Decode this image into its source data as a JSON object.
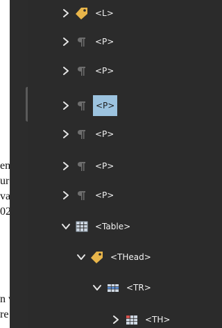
{
  "document_fragment": {
    "lines": [
      "en",
      "ur",
      "va",
      "02",
      "n v",
      "re"
    ]
  },
  "tag_tree": {
    "rows": [
      {
        "toggle": "collapsed",
        "icon": "tag-icon",
        "label": "<L>"
      },
      {
        "toggle": "collapsed",
        "icon": "paragraph-icon",
        "label": "<P>"
      },
      {
        "toggle": "collapsed",
        "icon": "paragraph-icon",
        "label": "<P>"
      },
      {
        "toggle": "collapsed",
        "icon": "paragraph-icon",
        "label": "<P>",
        "selected": true
      },
      {
        "toggle": "collapsed",
        "icon": "paragraph-icon",
        "label": "<P>"
      },
      {
        "toggle": "collapsed",
        "icon": "paragraph-icon",
        "label": "<P>"
      },
      {
        "toggle": "collapsed",
        "icon": "paragraph-icon",
        "label": "<P>"
      },
      {
        "toggle": "expanded",
        "icon": "table-icon",
        "label": "<Table>"
      },
      {
        "toggle": "expanded",
        "icon": "tag-icon",
        "label": "<THead>"
      },
      {
        "toggle": "expanded",
        "icon": "table-row-icon",
        "label": "<TR>"
      },
      {
        "toggle": "collapsed",
        "icon": "table-header-cell-icon",
        "label": "<TH>"
      }
    ]
  },
  "colors": {
    "panel_bg": "#2b2b2b",
    "selection_bg": "#9cc3df",
    "tag_icon": "#e8b54a",
    "paragraph_icon": "#6e6e6e",
    "table_icon": "#cfd8e3",
    "table_header_accent": "#d9534f"
  }
}
